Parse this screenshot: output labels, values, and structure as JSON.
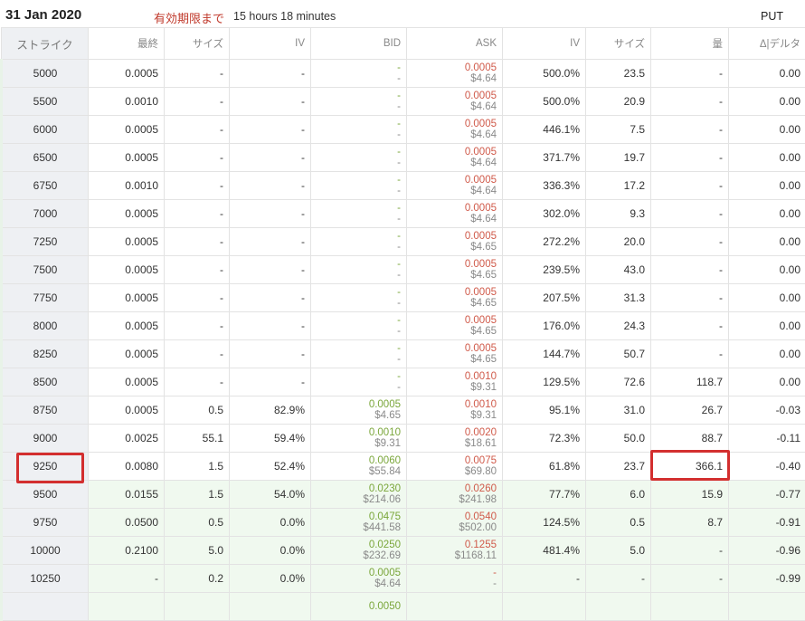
{
  "header": {
    "date": "31 Jan 2020",
    "expiry_label": "有効期限まで",
    "expiry_value": "15 hours 18 minutes",
    "side": "PUT"
  },
  "columns": [
    "ストライク",
    "最終",
    "サイズ",
    "IV",
    "BID",
    "ASK",
    "IV",
    "サイズ",
    "量",
    "Δ|デルタ"
  ],
  "rows": [
    {
      "strike": "5000",
      "last": "0.0005",
      "size": "-",
      "iv": "-",
      "bid": "-",
      "bid_usd": "-",
      "ask": "0.0005",
      "ask_usd": "$4.64",
      "iv2": "500.0%",
      "size2": "23.5",
      "vol": "-",
      "delta": "0.00",
      "itm": false
    },
    {
      "strike": "5500",
      "last": "0.0010",
      "size": "-",
      "iv": "-",
      "bid": "-",
      "bid_usd": "-",
      "ask": "0.0005",
      "ask_usd": "$4.64",
      "iv2": "500.0%",
      "size2": "20.9",
      "vol": "-",
      "delta": "0.00",
      "itm": false
    },
    {
      "strike": "6000",
      "last": "0.0005",
      "size": "-",
      "iv": "-",
      "bid": "-",
      "bid_usd": "-",
      "ask": "0.0005",
      "ask_usd": "$4.64",
      "iv2": "446.1%",
      "size2": "7.5",
      "vol": "-",
      "delta": "0.00",
      "itm": false
    },
    {
      "strike": "6500",
      "last": "0.0005",
      "size": "-",
      "iv": "-",
      "bid": "-",
      "bid_usd": "-",
      "ask": "0.0005",
      "ask_usd": "$4.64",
      "iv2": "371.7%",
      "size2": "19.7",
      "vol": "-",
      "delta": "0.00",
      "itm": false
    },
    {
      "strike": "6750",
      "last": "0.0010",
      "size": "-",
      "iv": "-",
      "bid": "-",
      "bid_usd": "-",
      "ask": "0.0005",
      "ask_usd": "$4.64",
      "iv2": "336.3%",
      "size2": "17.2",
      "vol": "-",
      "delta": "0.00",
      "itm": false
    },
    {
      "strike": "7000",
      "last": "0.0005",
      "size": "-",
      "iv": "-",
      "bid": "-",
      "bid_usd": "-",
      "ask": "0.0005",
      "ask_usd": "$4.64",
      "iv2": "302.0%",
      "size2": "9.3",
      "vol": "-",
      "delta": "0.00",
      "itm": false
    },
    {
      "strike": "7250",
      "last": "0.0005",
      "size": "-",
      "iv": "-",
      "bid": "-",
      "bid_usd": "-",
      "ask": "0.0005",
      "ask_usd": "$4.65",
      "iv2": "272.2%",
      "size2": "20.0",
      "vol": "-",
      "delta": "0.00",
      "itm": false
    },
    {
      "strike": "7500",
      "last": "0.0005",
      "size": "-",
      "iv": "-",
      "bid": "-",
      "bid_usd": "-",
      "ask": "0.0005",
      "ask_usd": "$4.65",
      "iv2": "239.5%",
      "size2": "43.0",
      "vol": "-",
      "delta": "0.00",
      "itm": false
    },
    {
      "strike": "7750",
      "last": "0.0005",
      "size": "-",
      "iv": "-",
      "bid": "-",
      "bid_usd": "-",
      "ask": "0.0005",
      "ask_usd": "$4.65",
      "iv2": "207.5%",
      "size2": "31.3",
      "vol": "-",
      "delta": "0.00",
      "itm": false
    },
    {
      "strike": "8000",
      "last": "0.0005",
      "size": "-",
      "iv": "-",
      "bid": "-",
      "bid_usd": "-",
      "ask": "0.0005",
      "ask_usd": "$4.65",
      "iv2": "176.0%",
      "size2": "24.3",
      "vol": "-",
      "delta": "0.00",
      "itm": false
    },
    {
      "strike": "8250",
      "last": "0.0005",
      "size": "-",
      "iv": "-",
      "bid": "-",
      "bid_usd": "-",
      "ask": "0.0005",
      "ask_usd": "$4.65",
      "iv2": "144.7%",
      "size2": "50.7",
      "vol": "-",
      "delta": "0.00",
      "itm": false
    },
    {
      "strike": "8500",
      "last": "0.0005",
      "size": "-",
      "iv": "-",
      "bid": "-",
      "bid_usd": "-",
      "ask": "0.0010",
      "ask_usd": "$9.31",
      "iv2": "129.5%",
      "size2": "72.6",
      "vol": "118.7",
      "delta": "0.00",
      "itm": false
    },
    {
      "strike": "8750",
      "last": "0.0005",
      "size": "0.5",
      "iv": "82.9%",
      "bid": "0.0005",
      "bid_usd": "$4.65",
      "ask": "0.0010",
      "ask_usd": "$9.31",
      "iv2": "95.1%",
      "size2": "31.0",
      "vol": "26.7",
      "delta": "-0.03",
      "itm": false
    },
    {
      "strike": "9000",
      "last": "0.0025",
      "size": "55.1",
      "iv": "59.4%",
      "bid": "0.0010",
      "bid_usd": "$9.31",
      "ask": "0.0020",
      "ask_usd": "$18.61",
      "iv2": "72.3%",
      "size2": "50.0",
      "vol": "88.7",
      "delta": "-0.11",
      "itm": false
    },
    {
      "strike": "9250",
      "last": "0.0080",
      "size": "1.5",
      "iv": "52.4%",
      "bid": "0.0060",
      "bid_usd": "$55.84",
      "ask": "0.0075",
      "ask_usd": "$69.80",
      "iv2": "61.8%",
      "size2": "23.7",
      "vol": "366.1",
      "delta": "-0.40",
      "itm": false
    },
    {
      "strike": "9500",
      "last": "0.0155",
      "size": "1.5",
      "iv": "54.0%",
      "bid": "0.0230",
      "bid_usd": "$214.06",
      "ask": "0.0260",
      "ask_usd": "$241.98",
      "iv2": "77.7%",
      "size2": "6.0",
      "vol": "15.9",
      "delta": "-0.77",
      "itm": true
    },
    {
      "strike": "9750",
      "last": "0.0500",
      "size": "0.5",
      "iv": "0.0%",
      "bid": "0.0475",
      "bid_usd": "$441.58",
      "ask": "0.0540",
      "ask_usd": "$502.00",
      "iv2": "124.5%",
      "size2": "0.5",
      "vol": "8.7",
      "delta": "-0.91",
      "itm": true
    },
    {
      "strike": "10000",
      "last": "0.2100",
      "size": "5.0",
      "iv": "0.0%",
      "bid": "0.0250",
      "bid_usd": "$232.69",
      "ask": "0.1255",
      "ask_usd": "$1168.11",
      "iv2": "481.4%",
      "size2": "5.0",
      "vol": "-",
      "delta": "-0.96",
      "itm": true
    },
    {
      "strike": "10250",
      "last": "-",
      "size": "0.2",
      "iv": "0.0%",
      "bid": "0.0005",
      "bid_usd": "$4.64",
      "ask": "-",
      "ask_usd": "-",
      "iv2": "-",
      "size2": "-",
      "vol": "-",
      "delta": "-0.99",
      "itm": true
    },
    {
      "strike": "",
      "last": "",
      "size": "",
      "iv": "",
      "bid": "0.0050",
      "bid_usd": "",
      "ask": "",
      "ask_usd": "",
      "iv2": "",
      "size2": "",
      "vol": "",
      "delta": "",
      "itm": true
    }
  ],
  "highlights": [
    "9250 strike cell",
    "366.1 volume cell"
  ]
}
